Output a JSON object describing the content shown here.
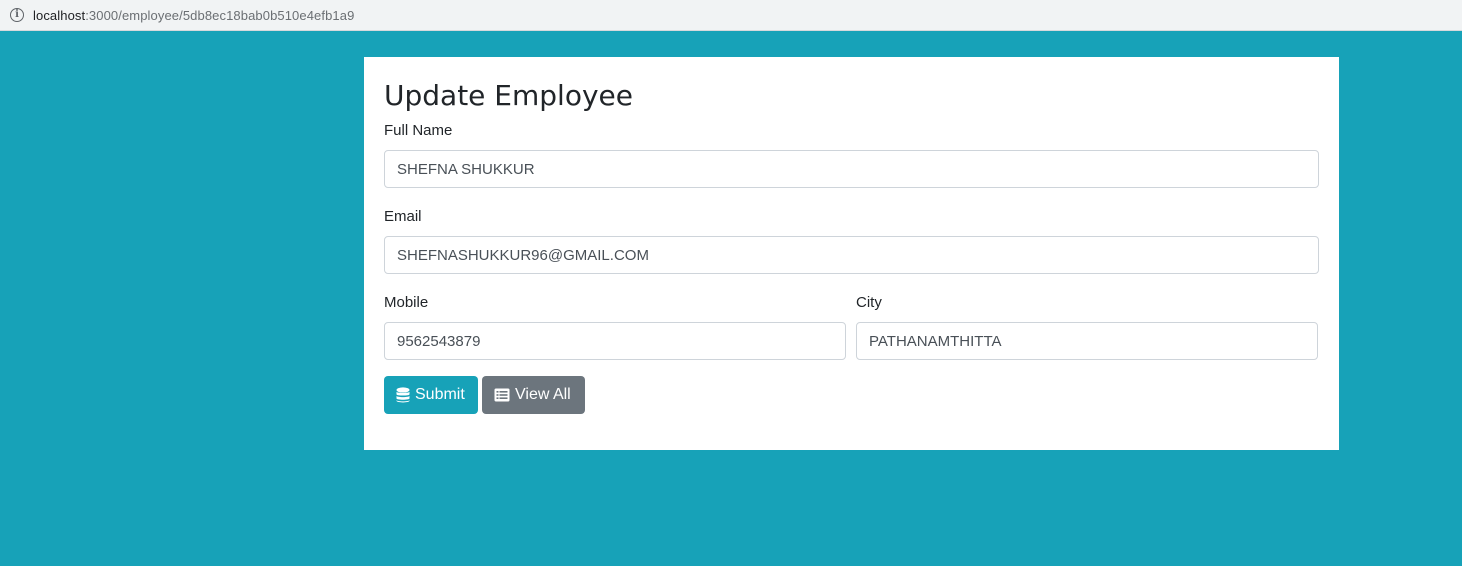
{
  "browser": {
    "url_host": "localhost",
    "url_path": ":3000/employee/5db8ec18bab0b510e4efb1a9"
  },
  "form": {
    "title": "Update Employee",
    "fields": {
      "fullName": {
        "label": "Full Name",
        "value": "SHEFNA SHUKKUR"
      },
      "email": {
        "label": "Email",
        "value": "SHEFNASHUKKUR96@GMAIL.COM"
      },
      "mobile": {
        "label": "Mobile",
        "value": "9562543879"
      },
      "city": {
        "label": "City",
        "value": "PATHANAMTHITTA"
      }
    },
    "buttons": {
      "submit": {
        "label": "Submit",
        "icon": "database-icon"
      },
      "viewAll": {
        "label": "View All",
        "icon": "list-alt-icon"
      }
    }
  },
  "colors": {
    "background": "#17a2b8",
    "submit": "#17a2b8",
    "viewAll": "#6c757d"
  }
}
